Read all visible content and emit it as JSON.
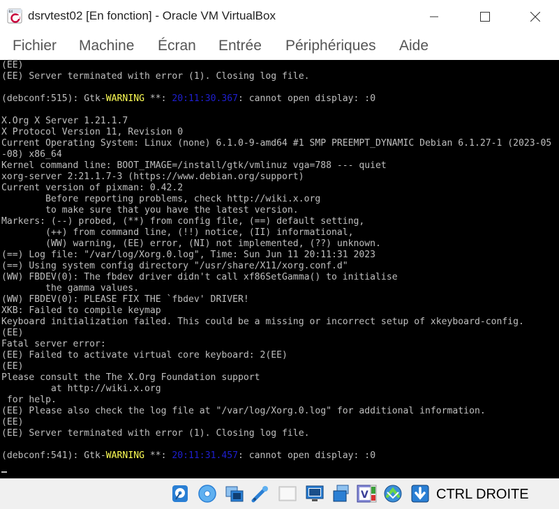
{
  "window": {
    "title": "dsrvtest02 [En fonction] - Oracle VM VirtualBox"
  },
  "menu": [
    "Fichier",
    "Machine",
    "Écran",
    "Entrée",
    "Périphériques",
    "Aide"
  ],
  "console": {
    "lines": [
      [
        [
          "(EE)",
          ""
        ]
      ],
      [
        [
          "(EE) Server terminated with error (1). Closing log file.",
          ""
        ]
      ],
      [
        [
          "",
          ""
        ]
      ],
      [
        [
          "(debconf:515): Gtk-",
          ""
        ],
        [
          "WARNING",
          "warn"
        ],
        [
          " **: ",
          ""
        ],
        [
          "20:11:30.367",
          "time"
        ],
        [
          ": cannot open display: :0",
          ""
        ]
      ],
      [
        [
          "",
          ""
        ]
      ],
      [
        [
          "X.Org X Server 1.21.1.7",
          ""
        ]
      ],
      [
        [
          "X Protocol Version 11, Revision 0",
          ""
        ]
      ],
      [
        [
          "Current Operating System: Linux (none) 6.1.0-9-amd64 #1 SMP PREEMPT_DYNAMIC Debian 6.1.27-1 (2023-05",
          ""
        ]
      ],
      [
        [
          "-08) x86_64",
          ""
        ]
      ],
      [
        [
          "Kernel command line: BOOT_IMAGE=/install/gtk/vmlinuz vga=788 --- quiet",
          ""
        ]
      ],
      [
        [
          "xorg-server 2:21.1.7-3 (https://www.debian.org/support)",
          ""
        ]
      ],
      [
        [
          "Current version of pixman: 0.42.2",
          ""
        ]
      ],
      [
        [
          "        Before reporting problems, check http://wiki.x.org",
          ""
        ]
      ],
      [
        [
          "        to make sure that you have the latest version.",
          ""
        ]
      ],
      [
        [
          "Markers: (--) probed, (**) from config file, (==) default setting,",
          ""
        ]
      ],
      [
        [
          "        (++) from command line, (!!) notice, (II) informational,",
          ""
        ]
      ],
      [
        [
          "        (WW) warning, (EE) error, (NI) not implemented, (??) unknown.",
          ""
        ]
      ],
      [
        [
          "(==) Log file: \"/var/log/Xorg.0.log\", Time: Sun Jun 11 20:11:31 2023",
          ""
        ]
      ],
      [
        [
          "(==) Using system config directory \"/usr/share/X11/xorg.conf.d\"",
          ""
        ]
      ],
      [
        [
          "(WW) FBDEV(0): The fbdev driver didn't call xf86SetGamma() to initialise",
          ""
        ]
      ],
      [
        [
          "        the gamma values.",
          ""
        ]
      ],
      [
        [
          "(WW) FBDEV(0): PLEASE FIX THE `fbdev' DRIVER!",
          ""
        ]
      ],
      [
        [
          "XKB: Failed to compile keymap",
          ""
        ]
      ],
      [
        [
          "Keyboard initialization failed. This could be a missing or incorrect setup of xkeyboard-config.",
          ""
        ]
      ],
      [
        [
          "(EE)",
          ""
        ]
      ],
      [
        [
          "Fatal server error:",
          ""
        ]
      ],
      [
        [
          "(EE) Failed to activate virtual core keyboard: 2(EE)",
          ""
        ]
      ],
      [
        [
          "(EE)",
          ""
        ]
      ],
      [
        [
          "Please consult the The X.Org Foundation support",
          ""
        ]
      ],
      [
        [
          "         at http://wiki.x.org",
          ""
        ]
      ],
      [
        [
          " for help.",
          ""
        ]
      ],
      [
        [
          "(EE) Please also check the log file at \"/var/log/Xorg.0.log\" for additional information.",
          ""
        ]
      ],
      [
        [
          "(EE)",
          ""
        ]
      ],
      [
        [
          "(EE) Server terminated with error (1). Closing log file.",
          ""
        ]
      ],
      [
        [
          "",
          ""
        ]
      ],
      [
        [
          "(debconf:541): Gtk-",
          ""
        ],
        [
          "WARNING",
          "warn"
        ],
        [
          " **: ",
          ""
        ],
        [
          "20:11:31.457",
          "time"
        ],
        [
          ": cannot open display: :0",
          ""
        ]
      ]
    ]
  },
  "statusbar": {
    "icons": [
      "hard-disk-icon",
      "optical-drive-icon",
      "audio-icon",
      "network-icon",
      "usb-icon",
      "shared-folders-icon",
      "display-icon",
      "video-capture-icon",
      "virtualization-engine-icon",
      "mouse-integration-icon",
      "keyboard-capture-icon"
    ],
    "host_key": "CTRL DROITE"
  },
  "colors": {
    "console_bg": "#000000",
    "console_text": "#bfbfbf",
    "warning": "#ffff55",
    "timestamp": "#1f1fd0"
  }
}
